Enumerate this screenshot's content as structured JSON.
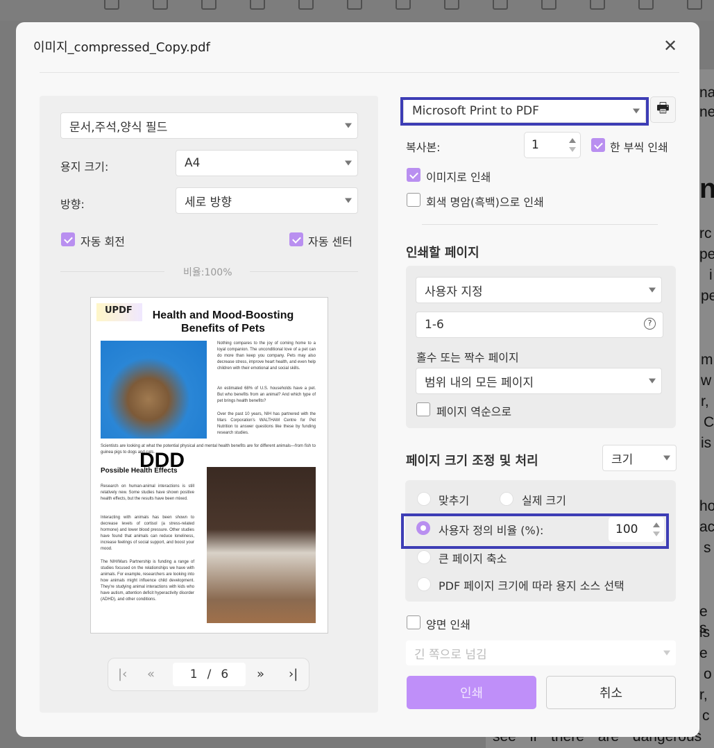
{
  "dialog": {
    "title": "이미지_compressed_Copy.pdf"
  },
  "left": {
    "content_select": "문서,주석,양식 필드",
    "paper_size_label": "용지 크기:",
    "paper_size": "A4",
    "orientation_label": "방향:",
    "orientation": "세로 방향",
    "auto_rotate": "자동 회전",
    "auto_center": "자동 센터",
    "scale_label": "비율:100%",
    "preview": {
      "logo": "UPDF",
      "title_line1": "Health and Mood-Boosting",
      "title_line2": "Benefits of Pets",
      "para1": "Nothing compares to the joy of coming home to a loyal companion. The unconditional love of a pet can do more than keep you company. Pets may also decrease stress, improve heart health, and even help children with their emotional and social skills.",
      "para2": "An estimated 68% of U.S. households have a pet. But who benefits from an animal? And which type of pet brings health benefits?",
      "para3": "Over the past 10 years, NIH has partnered with the Mars Corporation's WALTHAM Centre for Pet Nutrition to answer questions like these by funding research studies.",
      "para4": "Scientists are looking at what the potential physical and mental health benefits are for different animals—from fish to guinea pigs to dogs and cats.",
      "stamp": "DDD",
      "heading2": "Possible Health Effects",
      "para5": "Research on human-animal interactions is still relatively new. Some studies have shown positive health effects, but the results have been mixed.",
      "para6": "Interacting with animals has been shown to decrease levels of cortisol (a stress-related hormone) and lower blood pressure. Other studies have found that animals can reduce loneliness, increase feelings of social support, and boost your mood.",
      "para7": "The NIH/Mars Partnership is funding a range of studies focused on the relationships we have with animals. For example, researchers are looking into how animals might influence child development. They're studying animal interactions with kids who have autism, attention deficit hyperactivity disorder (ADHD), and other conditions."
    },
    "pager": {
      "current": "1",
      "sep": "/",
      "total": "6"
    }
  },
  "right": {
    "printer": "Microsoft Print to PDF",
    "copies_label": "복사본:",
    "copies": "1",
    "collate": "한 부씩 인쇄",
    "print_as_image": "이미지로 인쇄",
    "grayscale": "회색 명암(흑백)으로 인쇄",
    "pages_heading": "인쇄할 페이지",
    "pages_mode": "사용자 지정",
    "pages_range": "1-6",
    "odd_even_label": "홀수 또는 짝수 페이지",
    "odd_even": "범위 내의 모든 페이지",
    "reverse": "페이지 역순으로",
    "sizing_heading": "페이지 크기 조정 및 처리",
    "sizing_mode": "크기",
    "fit": "맞추기",
    "actual": "실제 크기",
    "custom_scale": "사용자 정의 비율 (%):",
    "custom_scale_value": "100",
    "shrink": "큰 페이지 축소",
    "choose_source": "PDF 페이지 크기에 따라 용지 소스 선택",
    "duplex": "양면 인쇄",
    "flip": "긴 쪽으로 넘김",
    "print_button": "인쇄",
    "cancel_button": "취소",
    "accent": "#b98ff0"
  },
  "background": {
    "fragments": [
      "nat",
      "ne",
      "ng",
      "rc",
      "pe",
      "i",
      "pe",
      "m",
      "w",
      "r,",
      "C",
      "is",
      "ho",
      "ach",
      "s",
      "e s",
      "is",
      "e",
      "o",
      "r,",
      "c",
      "see if there are dangerous"
    ]
  }
}
